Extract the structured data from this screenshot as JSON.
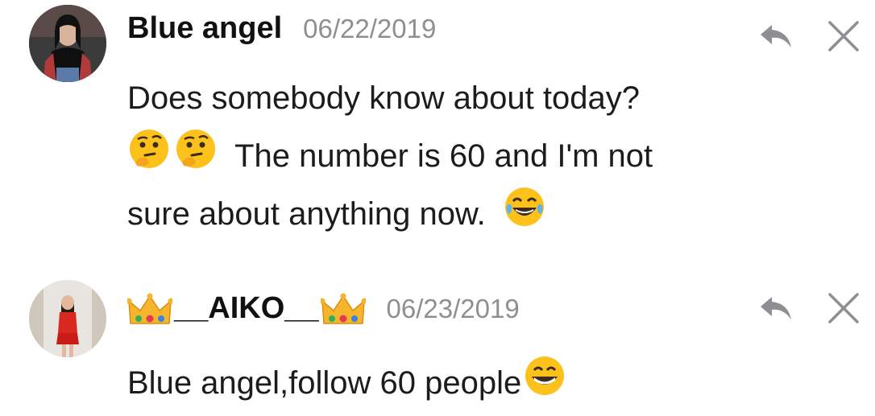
{
  "comments": [
    {
      "username": "Blue angel",
      "date": "06/22/2019",
      "lines": [
        "Does somebody know about today?",
        "The number is 60 and I'm not",
        "sure about anything now."
      ],
      "emojis": [
        "thinking-face",
        "thinking-face",
        "face-with-tears-of-joy"
      ]
    },
    {
      "username": "__AIKO__",
      "date": "06/23/2019",
      "lines": [
        "Blue angel,follow 60 people"
      ],
      "emojis": [
        "crown",
        "crown",
        "grinning-face"
      ]
    }
  ],
  "icons": {
    "reply": "reply-icon",
    "close": "close-icon"
  },
  "colors": {
    "username": "#111111",
    "date": "#8e8e93",
    "body": "#1c1c1e",
    "icon": "#8e8e93"
  }
}
